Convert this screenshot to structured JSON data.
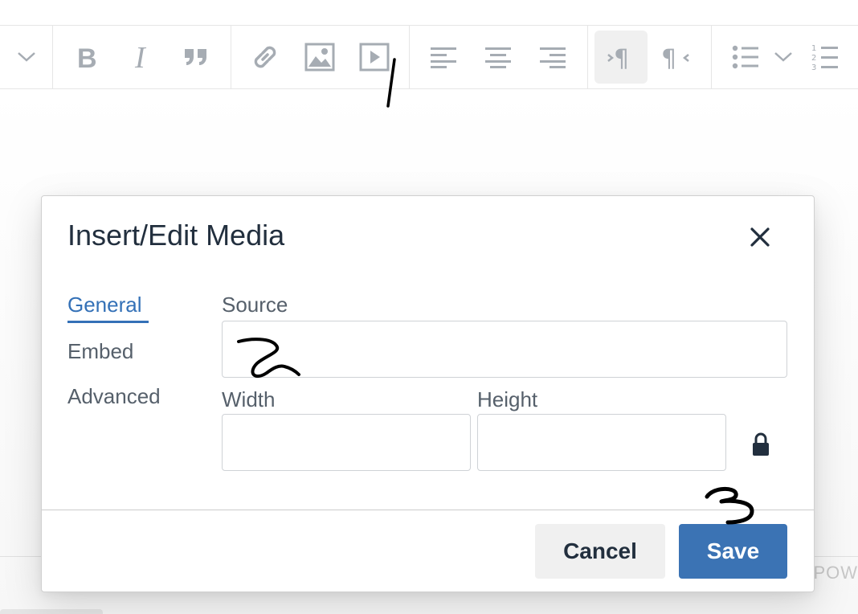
{
  "colors": {
    "accent": "#3471b7",
    "save_button": "#3b73b4",
    "text": "#222f3e",
    "muted": "#56606b",
    "icon": "#a6acb3"
  },
  "toolbar": {
    "icons": [
      "chevron-down-icon",
      "bold-icon",
      "italic-icon",
      "blockquote-icon",
      "link-icon",
      "image-icon",
      "media-icon",
      "align-left-icon",
      "align-center-icon",
      "align-right-icon",
      "ltr-icon",
      "rtl-icon",
      "bullet-list-icon",
      "chevron-down-icon",
      "numbered-list-icon"
    ]
  },
  "statusbar": {
    "text": "POW"
  },
  "dialog": {
    "title": "Insert/Edit Media",
    "tabs": [
      {
        "label": "General",
        "active": true
      },
      {
        "label": "Embed",
        "active": false
      },
      {
        "label": "Advanced",
        "active": false
      }
    ],
    "source": {
      "label": "Source",
      "value": ""
    },
    "width": {
      "label": "Width",
      "value": ""
    },
    "height": {
      "label": "Height",
      "value": ""
    },
    "buttons": {
      "cancel": "Cancel",
      "save": "Save"
    }
  },
  "annotations": [
    "1",
    "2",
    "3"
  ]
}
